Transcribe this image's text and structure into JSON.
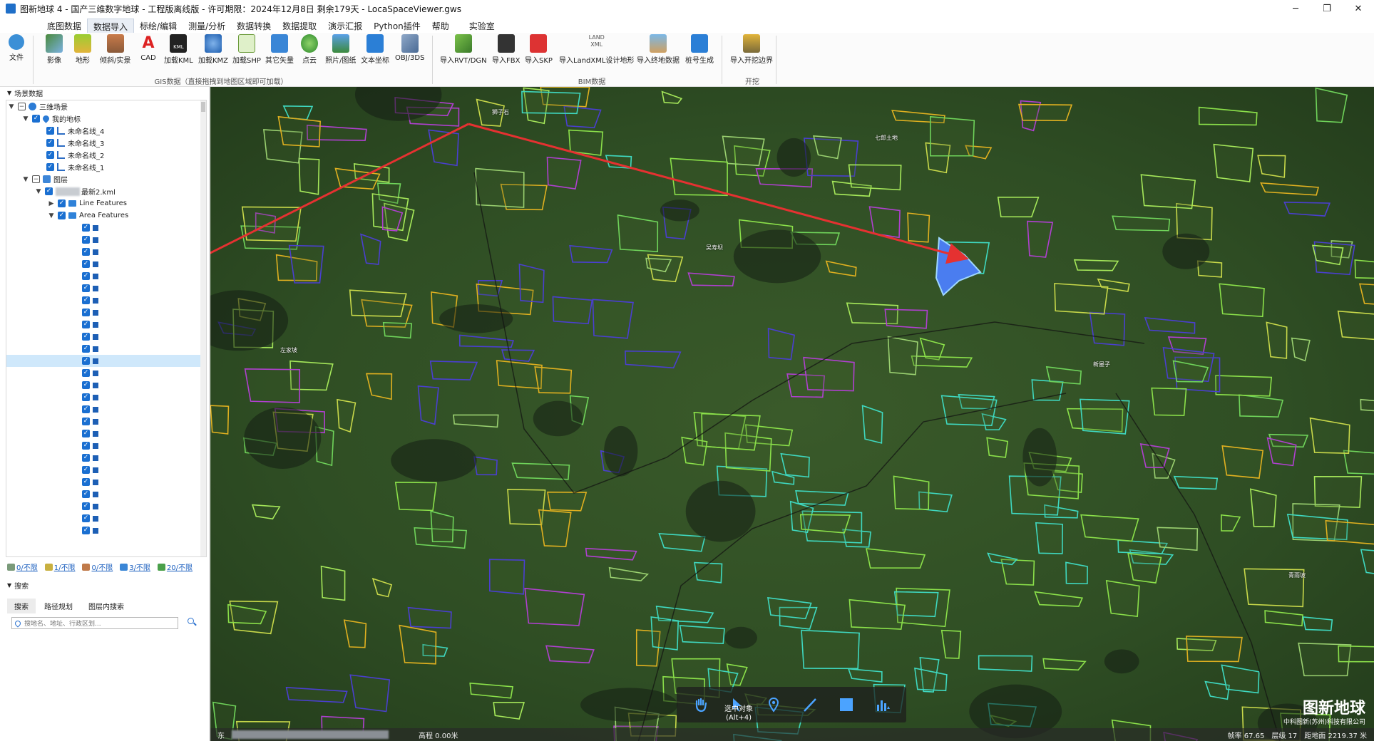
{
  "window": {
    "title": "图新地球 4 - 国产三维数字地球 - 工程版离线版 - 许可期限：2024年12月8日 剩余179天 - LocaSpaceViewer.gws",
    "minimize": "─",
    "maximize": "❐",
    "close": "✕"
  },
  "menu": [
    "底图数据",
    "数据导入",
    "标绘/编辑",
    "测量/分析",
    "数据转换",
    "数据提取",
    "演示汇报",
    "Python插件",
    "帮助",
    "实验室"
  ],
  "menu_active": "数据导入",
  "ribbon": {
    "file": "文件",
    "gis_buttons": [
      "影像",
      "地形",
      "倾斜/实景",
      "CAD",
      "加载KML",
      "加载KMZ",
      "加载SHP",
      "其它矢量",
      "点云",
      "照片/图纸",
      "文本坐标",
      "OBJ/3DS"
    ],
    "bim_buttons": [
      "导入RVT/DGN",
      "导入FBX",
      "导入SKP",
      "导入LandXML设计地形",
      "导入终地数据",
      "桩号生成"
    ],
    "excavation_buttons": [
      "导入开挖边界"
    ],
    "group_gis": "GIS数据（直接拖拽到地图区域即可加载）",
    "group_bim": "BIM数据",
    "group_excavation": "开挖",
    "icon_labels": {
      "cad": "A",
      "kml": "KML",
      "land": "LAND XML"
    }
  },
  "left_panel": {
    "header": "场景数据",
    "tree": {
      "root": "三维场景",
      "my_marks": "我的地标",
      "marks": [
        "未命名线_4",
        "未命名线_3",
        "未命名线_2",
        "未命名线_1"
      ],
      "layers": "图层",
      "kml_file": "最新2.kml",
      "line_features": "Line Features",
      "area_features": "Area Features"
    },
    "stats": [
      "0/不限",
      "1/不限",
      "0/不限",
      "3/不限",
      "20/不限"
    ],
    "search_header": "搜索",
    "search_tabs": [
      "搜索",
      "路径规划",
      "图层内搜索"
    ],
    "search_placeholder": "搜地名、地址、行政区划..."
  },
  "map": {
    "places": [
      "狮子石",
      "七郎土地",
      "吴寿坝",
      "左家坡",
      "新屋子",
      "青雨坡"
    ],
    "tool_tooltip": "选中对象",
    "tool_shortcut": "(Alt+4)",
    "brand": "图新地球",
    "brand_sub": "中科图新(苏州)科技有限公司",
    "status": {
      "lon_label": "东",
      "elevation": "高程 0.00米",
      "fps": "帧率 67.65",
      "level": "层级 17",
      "distance": "距地面 2219.37 米"
    }
  },
  "colors": {
    "selected_polygon": "#4a7df0",
    "arrow": "#e53131",
    "accent": "#1a6fd1"
  }
}
